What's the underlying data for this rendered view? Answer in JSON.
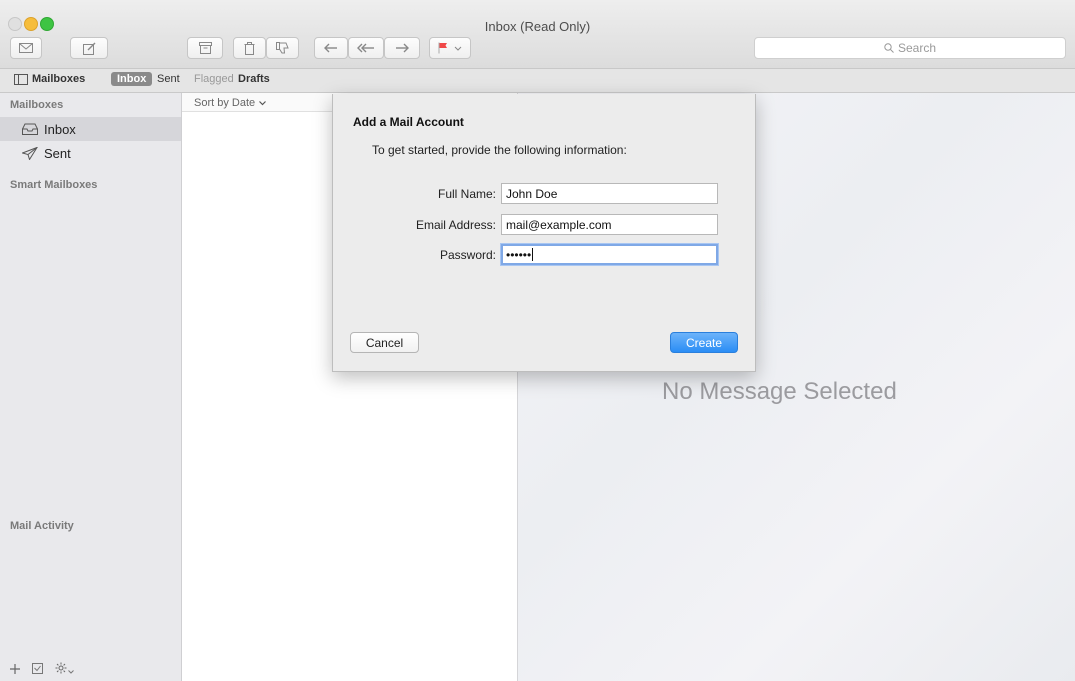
{
  "window": {
    "title": "Inbox (Read Only)"
  },
  "toolbar": {
    "search_placeholder": "Search",
    "buttons": [
      {
        "name": "get-mail-button",
        "icon": "envelope-icon"
      },
      {
        "name": "compose-button",
        "icon": "compose-icon"
      },
      {
        "name": "archive-button",
        "icon": "archive-icon"
      },
      {
        "name": "delete-button",
        "icon": "trash-icon"
      },
      {
        "name": "junk-button",
        "icon": "thumbs-down-icon"
      },
      {
        "name": "reply-button",
        "icon": "reply-icon"
      },
      {
        "name": "reply-all-button",
        "icon": "reply-all-icon"
      },
      {
        "name": "forward-button",
        "icon": "forward-icon"
      },
      {
        "name": "flag-button",
        "icon": "flag-icon"
      }
    ]
  },
  "favorites": {
    "mailboxes": "Mailboxes",
    "inbox": "Inbox",
    "sent": "Sent",
    "flagged": "Flagged",
    "drafts": "Drafts"
  },
  "sidebar": {
    "section_mailboxes": "Mailboxes",
    "items": [
      {
        "label": "Inbox",
        "icon": "inbox-tray-icon",
        "selected": true
      },
      {
        "label": "Sent",
        "icon": "paper-plane-icon",
        "selected": false
      }
    ],
    "section_smart": "Smart Mailboxes",
    "section_activity": "Mail Activity"
  },
  "message_list": {
    "sort_label": "Sort by Date"
  },
  "viewer": {
    "empty_text": "No Message Selected"
  },
  "dialog": {
    "title": "Add a Mail Account",
    "intro": "To get started, provide the following information:",
    "fields": [
      {
        "label": "Full Name:",
        "value": "John Doe"
      },
      {
        "label": "Email Address:",
        "value": "mail@example.com"
      },
      {
        "label": "Password:",
        "value": "••••••"
      }
    ],
    "cancel_label": "Cancel",
    "create_label": "Create"
  },
  "colors": {
    "accent": "#2a8df5",
    "close": "#e0e0e0",
    "minimize": "#f6bd3b",
    "maximize": "#3ec443",
    "flag": "#f04848"
  }
}
